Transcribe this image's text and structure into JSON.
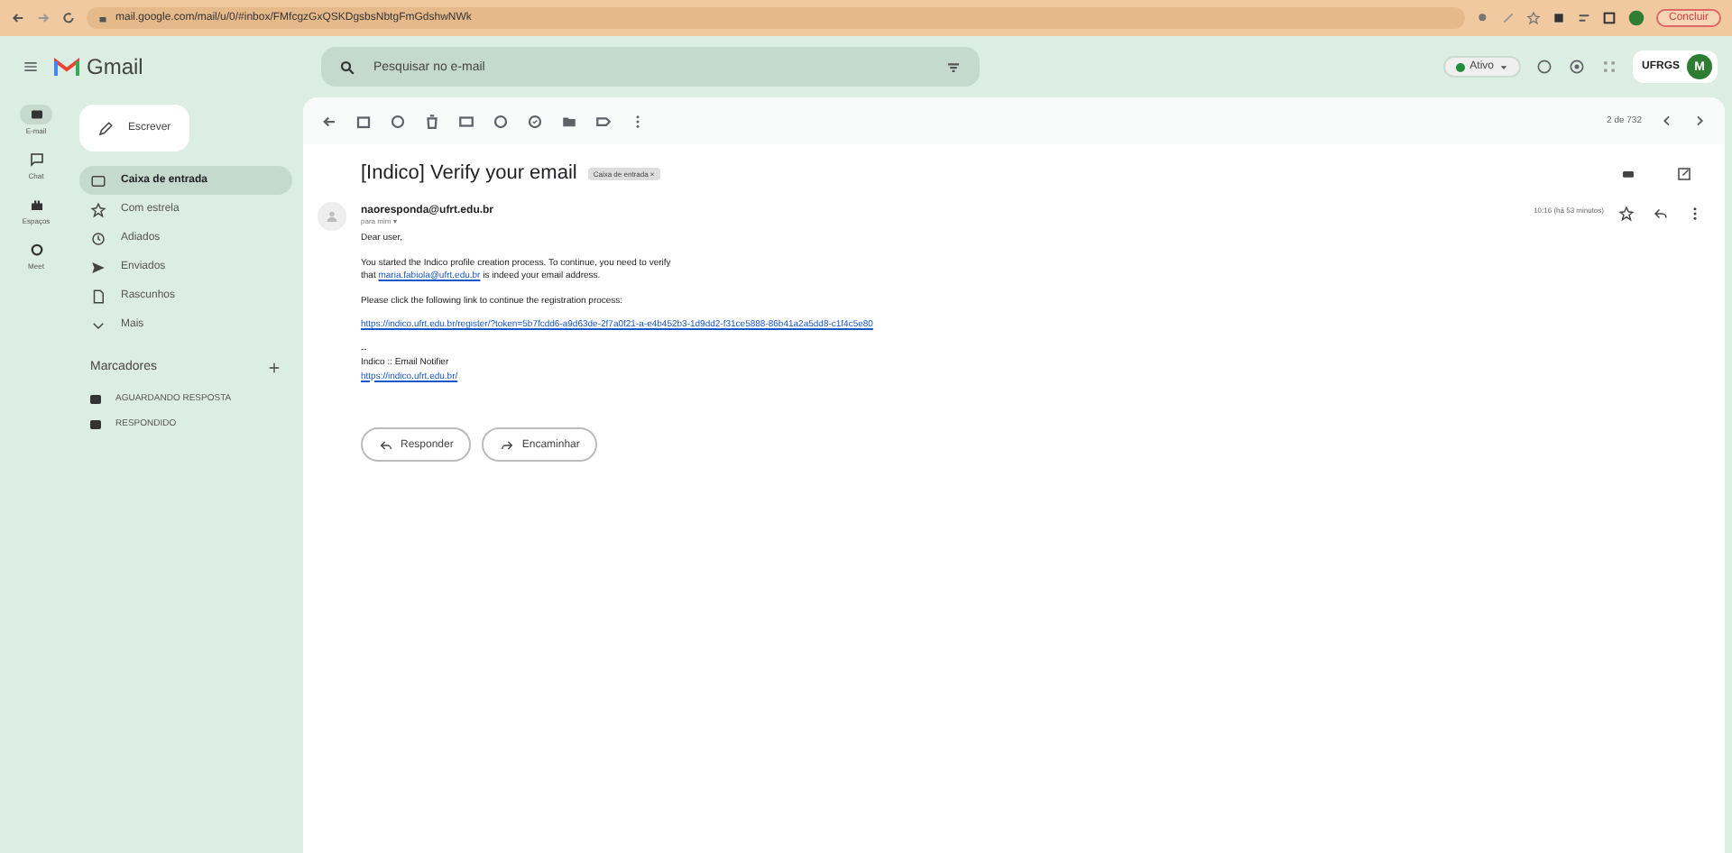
{
  "browser": {
    "url": "mail.google.com/mail/u/0/#inbox/FMfcgzGxQSKDgsbsNbtgFmGdshwNWk",
    "action_button": "Concluir"
  },
  "header": {
    "logo": "Gmail",
    "search": {
      "placeholder": "Pesquisar no e-mail"
    },
    "status": "Ativo",
    "account": "UFRGS",
    "avatar": "M"
  },
  "rail": [
    {
      "label": "E-mail",
      "selected": true
    },
    {
      "label": "Chat",
      "selected": false
    },
    {
      "label": "Espaços",
      "selected": false
    },
    {
      "label": "Meet",
      "selected": false
    }
  ],
  "compose": "Escrever",
  "folders": [
    {
      "label": "Caixa de entrada",
      "selected": true
    },
    {
      "label": "Com estrela",
      "selected": false
    },
    {
      "label": "Adiados",
      "selected": false
    },
    {
      "label": "Enviados",
      "selected": false
    },
    {
      "label": "Rascunhos",
      "selected": false
    },
    {
      "label": "Mais",
      "selected": false
    }
  ],
  "labels_heading": "Marcadores",
  "labels": [
    "AGUARDANDO RESPOSTA",
    "RESPONDIDO"
  ],
  "pager": "2 de 732",
  "message": {
    "subject": "[Indico] Verify your email",
    "tag": "Caixa de entrada ×",
    "sender": "naoresponda@ufrt.edu.br",
    "recipient": "para mim ▾",
    "time": "10:16 (há 53 minutos)",
    "greeting": "Dear user,",
    "line_1": "You started the Indico profile creation process. To continue, you need to verify",
    "line_2_start": "that",
    "email_link": "maria.fabiola@ufrt.edu.br",
    "line_2_end": "is indeed your email address.",
    "line_3": "Please click the following link to continue the registration process:",
    "verify_link": "https://indico.ufrt.edu.br/register/?token=5b7fcdd6-a9d63de-2f7a0f21-a-e4b452b3-1d9dd2-f31ce5888-86b41a2a5dd8-c1f4c5e80",
    "separator": "--",
    "signature": "Indico :: Email Notifier",
    "site_link": "https://indico.ufrt.edu.br/"
  },
  "actions": [
    "Responder",
    "Encaminhar"
  ]
}
